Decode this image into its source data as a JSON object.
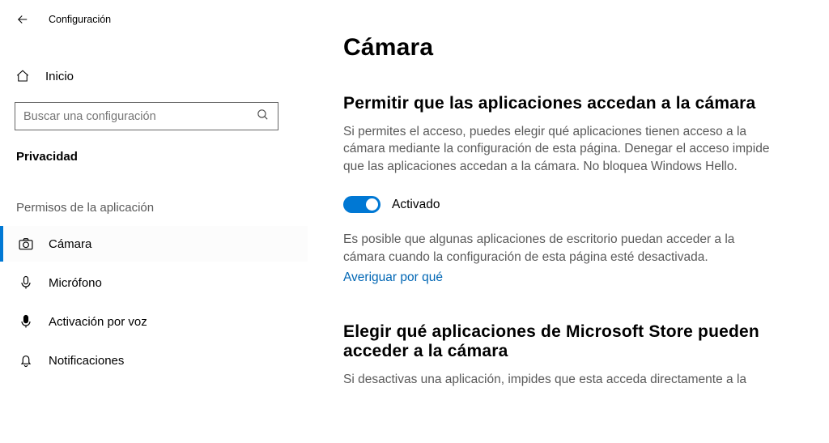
{
  "app": {
    "title": "Configuración",
    "home_label": "Inicio",
    "search_placeholder": "Buscar una configuración",
    "current_section": "Privacidad"
  },
  "sidebar": {
    "group_header": "Permisos de la aplicación",
    "items": [
      {
        "label": "Cámara",
        "icon": "camera"
      },
      {
        "label": "Micrófono",
        "icon": "microphone"
      },
      {
        "label": "Activación por voz",
        "icon": "voice"
      },
      {
        "label": "Notificaciones",
        "icon": "bell"
      }
    ]
  },
  "main": {
    "heading": "Cámara",
    "section1": {
      "title": "Permitir que las aplicaciones accedan a la cámara",
      "desc": "Si permites el acceso, puedes elegir qué aplicaciones tienen acceso a la cámara mediante la configuración de esta página. Denegar el acceso impide que las aplicaciones accedan a la cámara. No bloquea Windows Hello.",
      "toggle_label": "Activado",
      "note": "Es posible que algunas aplicaciones de escritorio puedan acceder a la cámara cuando la configuración de esta página esté desactivada.",
      "link": "Averiguar por qué"
    },
    "section2": {
      "title": "Elegir qué aplicaciones de Microsoft Store pueden acceder a la cámara",
      "desc": "Si desactivas una aplicación, impides que esta acceda directamente a la"
    }
  }
}
